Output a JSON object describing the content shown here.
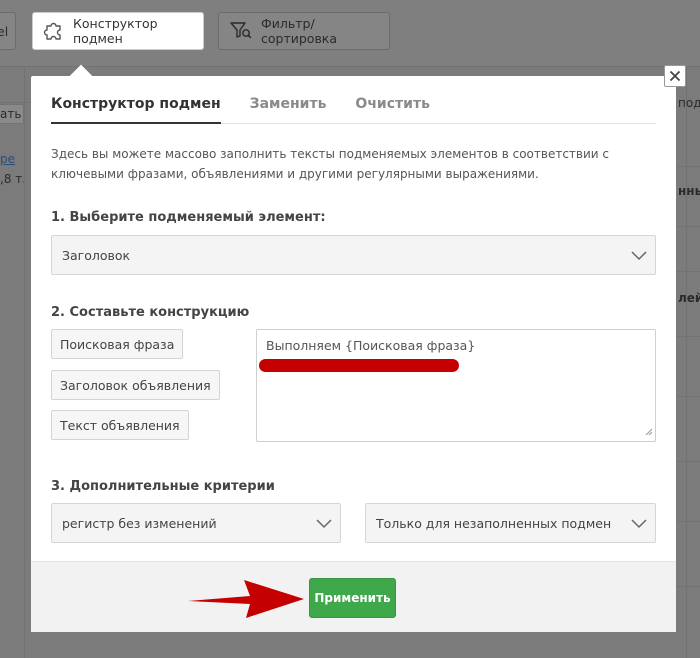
{
  "toolbar": {
    "left_stub_label": "el",
    "constructor_label": "Конструктор подмен",
    "filter_label": "Фильтр/сортировка"
  },
  "background": {
    "left_button": "ать",
    "left_link": "ре",
    "left_text": ",8 т.",
    "right_texts": [
      "под",
      "нны",
      "лей"
    ]
  },
  "modal": {
    "tabs": [
      {
        "label": "Конструктор подмен",
        "active": true
      },
      {
        "label": "Заменить",
        "active": false
      },
      {
        "label": "Очистить",
        "active": false
      }
    ],
    "description": "Здесь вы можете массово заполнить тексты подменяемых элементов в соответствии с ключевыми фразами, объявлениями и другими регулярными выражениями.",
    "step1": {
      "title": "1. Выберите подменяемый элемент:",
      "selected": "Заголовок"
    },
    "step2": {
      "title": "2. Составьте конструкцию",
      "chips": [
        "Поисковая фраза",
        "Заголовок объявления",
        "Текст объявления"
      ],
      "textarea_value": "Выполняем {Поисковая фраза}"
    },
    "step3": {
      "title": "3. Дополнительные критерии",
      "case_selected": "регистр без изменений",
      "scope_selected": "Только для незаполненных подмен"
    },
    "apply_label": "Применить"
  },
  "colors": {
    "apply": "#3fa84a",
    "annotation": "#c40000"
  }
}
